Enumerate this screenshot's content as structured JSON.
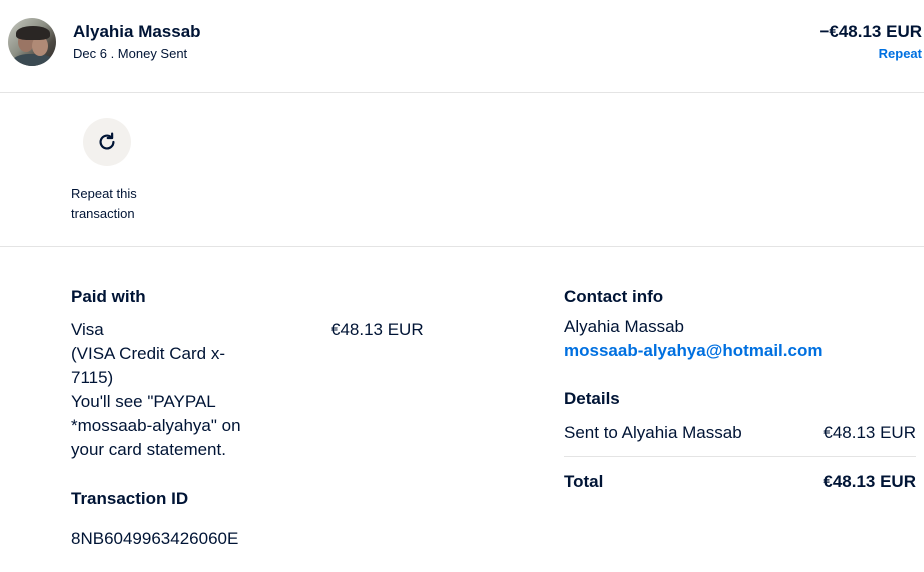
{
  "header": {
    "name": "Alyahia Massab",
    "subline": "Dec 6 . Money Sent",
    "amount": "−€48.13 EUR",
    "repeat_link": "Repeat"
  },
  "action": {
    "icon": "refresh-icon",
    "label": "Repeat this transaction"
  },
  "paid_with": {
    "title": "Paid with",
    "lines": [
      "Visa",
      "(VISA Credit Card x-",
      "7115)",
      "You'll see \"PAYPAL",
      "*mossaab-alyahya\" on",
      "your card statement."
    ],
    "amount": "€48.13 EUR"
  },
  "transaction": {
    "title": "Transaction ID",
    "id": "8NB6049963426060E"
  },
  "contact": {
    "title": "Contact info",
    "name": "Alyahia Massab",
    "email": "mossaab-alyahya@hotmail.com"
  },
  "details": {
    "title": "Details",
    "sent_label": "Sent to Alyahia Massab",
    "sent_amount": "€48.13 EUR",
    "total_label": "Total",
    "total_amount": "€48.13 EUR"
  },
  "colors": {
    "text": "#001435",
    "link": "#0070e0",
    "divider": "#e4e4e4"
  }
}
